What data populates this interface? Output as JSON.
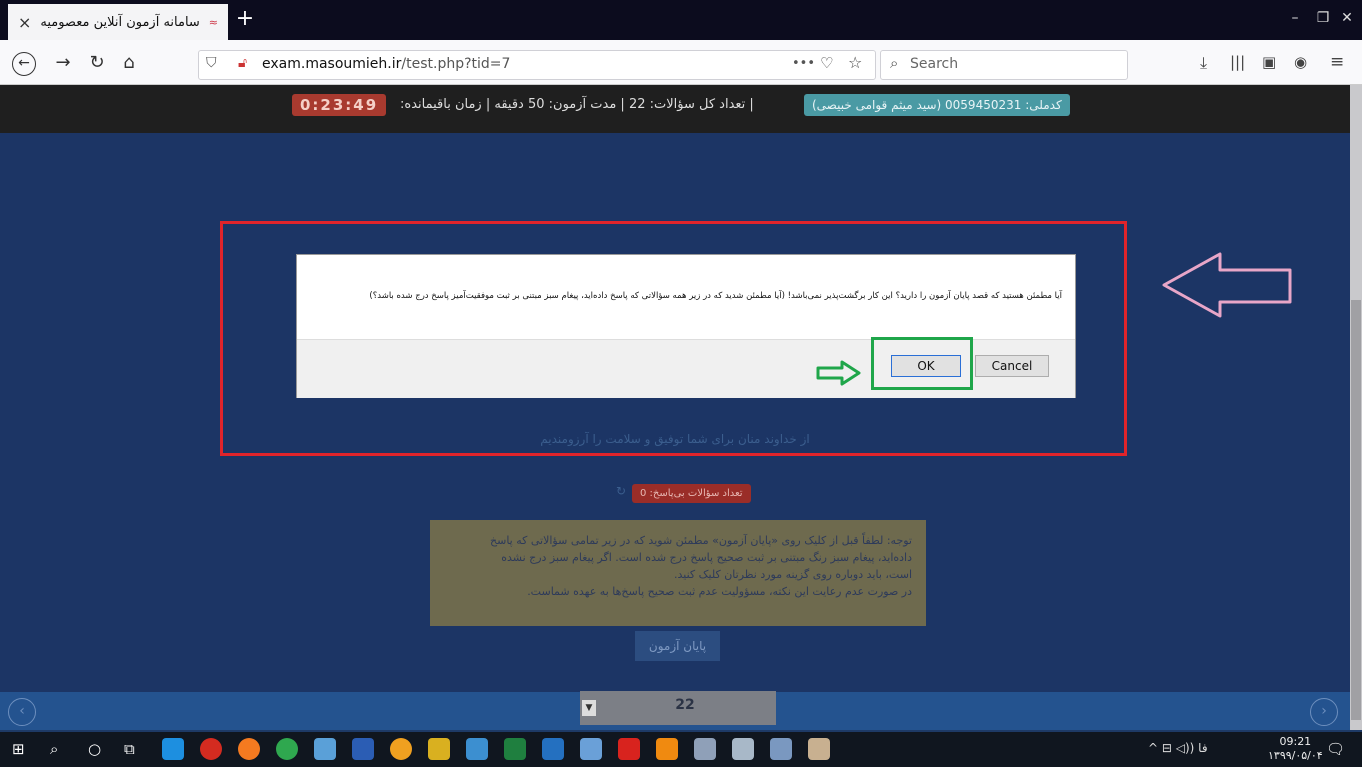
{
  "browser": {
    "tab_title": "سامانه آزمون آنلاین معصومیه",
    "tab_close": "×",
    "new_tab": "+",
    "url_host": "exam.masoumieh.ir",
    "url_path": "/test.php?tid=7",
    "search_placeholder": "Search",
    "more_dots": "•••",
    "window_minimize": "–",
    "window_restore": "❐",
    "window_close": "✕"
  },
  "exam_header": {
    "user_badge": "کدملی: 0059450231 (سید میثم قوامی خبیصی)",
    "stats": "|  تعداد کل سؤالات: 22   |   مدت آزمون: 50 دقیقه   |   زمان باقیمانده:",
    "timer": "0:23:49"
  },
  "dialog": {
    "message": "آیا مطمئن هستید که قصد پایان آزمون را دارید؟ این کار برگشت‌پذیر نمی‌باشد! (آیا مطمئن شدید که در زیر همه سؤالاتی که پاسخ داده‌اید، پیغام سبز مبتنی بر ثبت موفقیت‌آمیز پاسخ درج شده باشد؟)",
    "ok_label": "OK",
    "cancel_label": "Cancel"
  },
  "page": {
    "blessing": "از خداوند منان برای شما توفیق و سلامت را آرزومندیم",
    "unanswered_badge": "تعداد سؤالات بی‌پاسخ: 0",
    "note_lines": [
      "توجه: لطفاً قبل از کلیک روی «پایان آزمون» مطمئن شوید که در زیر تمامی سؤالاتی که پاسخ",
      "داده‌اید، پیغام سبز رنگ مبتنی بر ثبت صحیح پاسخ درج شده است. اگر پیغام سبز درج نشده",
      "است، باید دوباره روی گزینه مورد نظرتان کلیک کنید.",
      "در صورت عدم رعایت این نکته، مسؤولیت عدم ثبت صحیح پاسخ‌ها به عهده شماست."
    ],
    "finish_button": "پایان آزمون",
    "question_number": "22"
  },
  "taskbar": {
    "tray": "^  ⊟  ◁))   فا",
    "time": "09:21",
    "date": "۱۳۹۹/۰۵/۰۴"
  },
  "colors": {
    "annotation_red": "#e0242b",
    "annotation_green": "#1fa64a",
    "annotation_pink": "#e8a6c8"
  }
}
